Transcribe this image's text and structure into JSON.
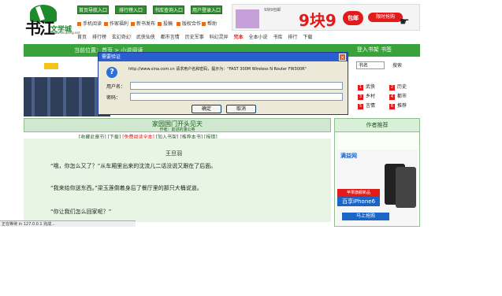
{
  "header": {
    "logo_callig": "书江",
    "logo_name": "文学城",
    "logo_url": "www.shujiang.net",
    "top_buttons": [
      "首页导航入口",
      "排行榜入口",
      "书库查询入口",
      "用户登录入口"
    ],
    "top_links": [
      "手机阅读",
      "作家福利",
      "新书发布",
      "投稿",
      "版权合作",
      "帮助"
    ],
    "ad_text": "9块9包邮",
    "ad_big": "9块9",
    "ad_pill": "包邮",
    "ad_button": "限时抢购"
  },
  "nav": {
    "items": [
      "首页",
      "排行榜",
      "玄幻奇幻",
      "武侠仙侠",
      "都市言情",
      "历史军事",
      "科幻灵异",
      "完本",
      "全本小说",
      "书库",
      "排行",
      "下载"
    ],
    "hot_item": "完本"
  },
  "greenbar": {
    "left_text": "当前位置：首页 > 小说阅读",
    "right_text": "登入书架 书签"
  },
  "search": {
    "select_value": "书名",
    "go_label": "搜索"
  },
  "sidebox": {
    "items": [
      "武侠",
      "历史",
      "乡村",
      "都市",
      "言情",
      "推荐"
    ]
  },
  "chapter": {
    "title": "家园国门开头见天",
    "subtitle": "作者：前进的蒲公英",
    "links_left": "[收藏此章节] [下载]",
    "links_hot": "[免费阅读全本]",
    "links_right": "[加入书架] [推荐本书] [报错]",
    "author": "王旦羽",
    "p1": "“哦，你怎么又了？”从车厢里出来的沈流儿二话没说又跟在了后面。",
    "p2": "“我来给你送东西。”梁玉莲倒着身后了餐厅里的那只大桶说道。",
    "p3": "“你让我们怎么回家呢？”"
  },
  "rightcol": {
    "header": "作者推荐",
    "ad_brand": "满益网",
    "ad_tag": "苹果旗舰新品",
    "ad_iphone": "百享iPhone6",
    "ad_buy": "马上抢购"
  },
  "status": "正在等待 in 127.0.0.1 完成...",
  "dialog": {
    "title": "需要验证",
    "close_glyph": "×",
    "message": "http://www.sina.com.cn 请求用户名和密码，提示为：\"FAST 300M Wireless N Router FW300R\"",
    "username_label": "用户名：",
    "password_label": "密码：",
    "username_value": "",
    "password_value": "",
    "ok_label": "确定",
    "cancel_label": "取消",
    "icon": "question-icon"
  }
}
